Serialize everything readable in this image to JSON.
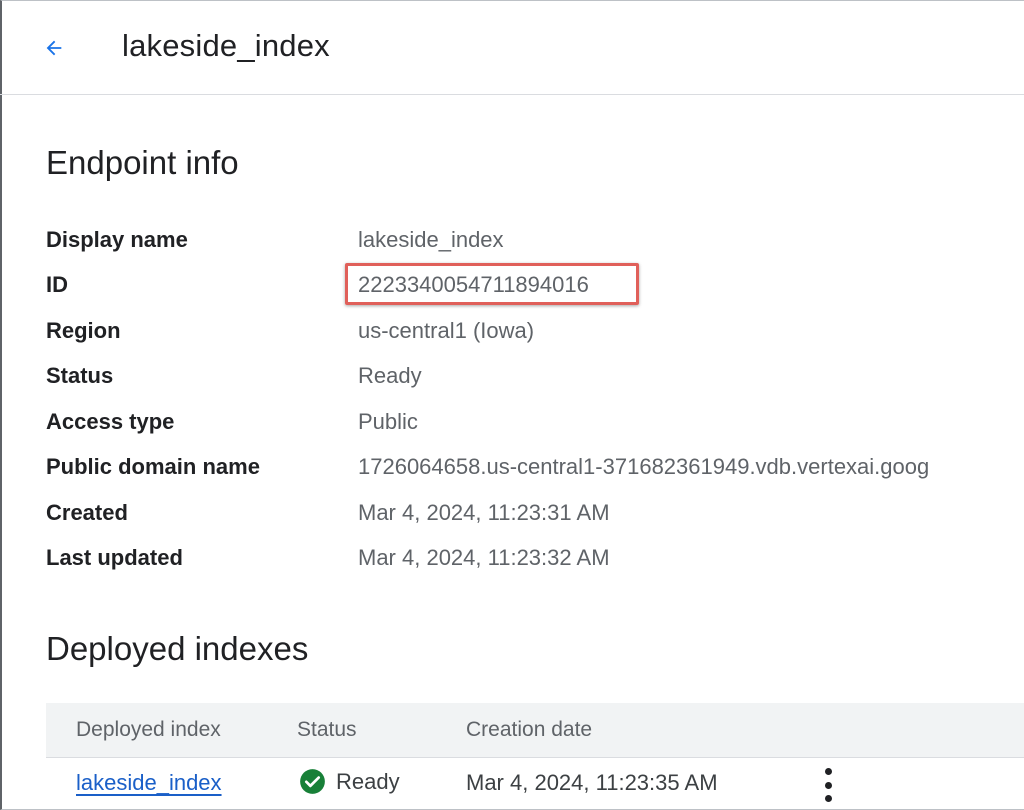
{
  "header": {
    "title": "lakeside_index",
    "back_icon": "arrow-back-icon"
  },
  "endpoint_info": {
    "section_title": "Endpoint info",
    "fields": [
      {
        "label": "Display name",
        "value": "lakeside_index"
      },
      {
        "label": "ID",
        "value": "2223340054711894016"
      },
      {
        "label": "Region",
        "value": "us-central1 (Iowa)"
      },
      {
        "label": "Status",
        "value": "Ready"
      },
      {
        "label": "Access type",
        "value": "Public"
      },
      {
        "label": "Public domain name",
        "value": "1726064658.us-central1-371682361949.vdb.vertexai.goog"
      },
      {
        "label": "Created",
        "value": "Mar 4, 2024, 11:23:31 AM"
      },
      {
        "label": "Last updated",
        "value": "Mar 4, 2024, 11:23:32 AM"
      }
    ]
  },
  "deployed_indexes": {
    "section_title": "Deployed indexes",
    "columns": [
      "Deployed index",
      "Status",
      "Creation date"
    ],
    "rows": [
      {
        "index": "lakeside_index",
        "status": "Ready",
        "status_icon": "check-circle-icon",
        "created": "Mar 4, 2024, 11:23:35 AM"
      }
    ]
  },
  "colors": {
    "accent": "#1a73e8",
    "link": "#1a5fc8",
    "success": "#188038",
    "highlight": "#e0605a"
  }
}
